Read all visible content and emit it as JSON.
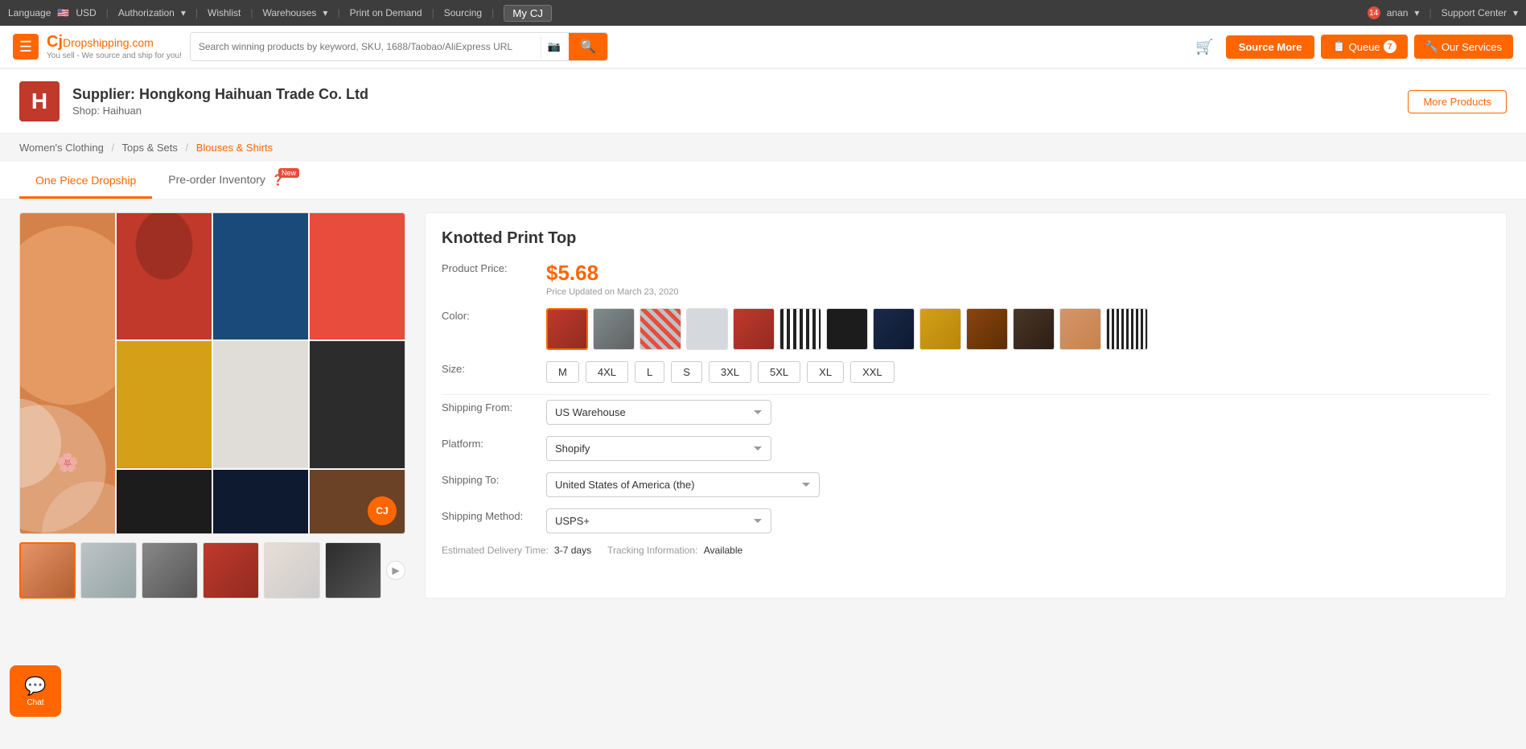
{
  "topnav": {
    "language": "Language",
    "flag": "🇺🇸",
    "currency": "USD",
    "authorization": "Authorization",
    "wishlist": "Wishlist",
    "warehouses": "Warehouses",
    "print_on_demand": "Print on Demand",
    "sourcing": "Sourcing",
    "my_cj": "My CJ",
    "notification_count": "14",
    "user": "anan",
    "support_center": "Support Center"
  },
  "header": {
    "logo_cj": "CJ",
    "logo_drop": "Dropshipping.com",
    "logo_sub": "You sell - We source and ship for you!",
    "search_placeholder": "Search winning products by keyword, SKU, 1688/Taobao/AliExpress URL",
    "source_more": "Source More",
    "queue_label": "Queue",
    "queue_count": "7",
    "services_label": "Our Services"
  },
  "supplier": {
    "avatar_letter": "H",
    "name": "Supplier: Hongkong Haihuan Trade Co. Ltd",
    "shop": "Shop: Haihuan",
    "more_products": "More Products"
  },
  "breadcrumb": {
    "items": [
      {
        "label": "Women's Clothing",
        "active": false
      },
      {
        "label": "Tops & Sets",
        "active": false
      },
      {
        "label": "Blouses & Shirts",
        "active": true
      }
    ]
  },
  "tabs": [
    {
      "label": "One Piece Dropship",
      "active": true,
      "new": false
    },
    {
      "label": "Pre-order Inventory",
      "active": false,
      "new": true
    }
  ],
  "product": {
    "name": "Knotted Print Top",
    "price": "$5.68",
    "price_updated": "Price Updated on March 23, 2020",
    "color_label": "Color:",
    "size_label": "Size:",
    "shipping_from_label": "Shipping From:",
    "shipping_from_value": "US Warehouse",
    "platform_label": "Platform:",
    "platform_value": "Shopify",
    "shipping_to_label": "Shipping To:",
    "shipping_to_value": "United States of America (the)",
    "shipping_method_label": "Shipping Method:",
    "shipping_method_value": "USPS+",
    "delivery_label": "Estimated Delivery Time:",
    "delivery_value": "3-7 days",
    "tracking_label": "Tracking Information:",
    "tracking_value": "Available",
    "sizes": [
      "M",
      "4XL",
      "L",
      "S",
      "3XL",
      "5XL",
      "XL",
      "XXL"
    ]
  },
  "chat": {
    "label": "Chat"
  }
}
